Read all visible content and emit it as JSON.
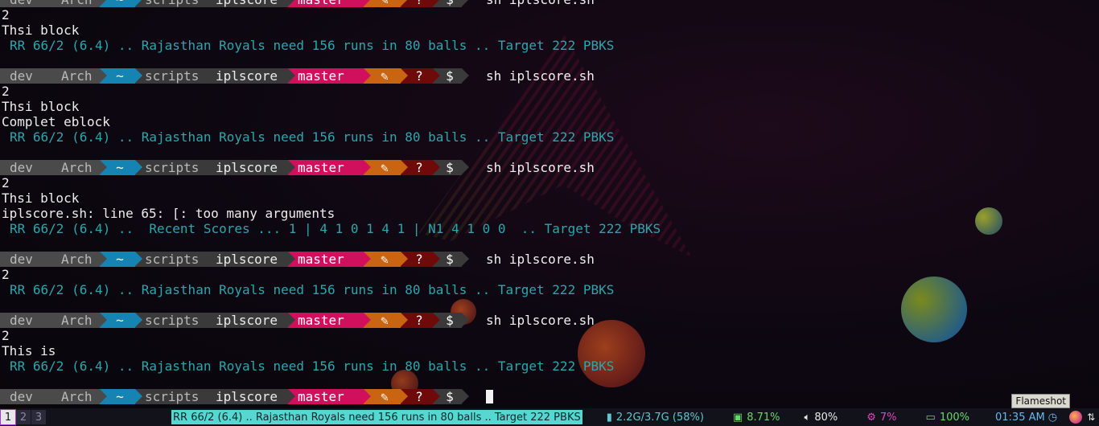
{
  "prompt": {
    "user": "dev",
    "host": "Arch",
    "home": "~",
    "dir1": "scripts",
    "dir2": "iplscore",
    "branch": "master",
    "edit": "✎",
    "status": "?",
    "symbol": "$"
  },
  "terminal_lines": [
    {
      "type": "prompt",
      "command": "sh iplscore.sh"
    },
    {
      "type": "plain",
      "text": "2"
    },
    {
      "type": "plain",
      "text": "Thsi block"
    },
    {
      "type": "score",
      "text": "RR 66/2 (6.4) .. Rajasthan Royals need 156 runs in 80 balls .. Target 222 PBKS"
    },
    {
      "type": "blank"
    },
    {
      "type": "prompt",
      "command": "sh iplscore.sh"
    },
    {
      "type": "plain",
      "text": "2"
    },
    {
      "type": "plain",
      "text": "Thsi block"
    },
    {
      "type": "plain",
      "text": "Complet eblock"
    },
    {
      "type": "score",
      "text": "RR 66/2 (6.4) .. Rajasthan Royals need 156 runs in 80 balls .. Target 222 PBKS"
    },
    {
      "type": "blank"
    },
    {
      "type": "prompt",
      "command": "sh iplscore.sh"
    },
    {
      "type": "plain",
      "text": "2"
    },
    {
      "type": "plain",
      "text": "Thsi block"
    },
    {
      "type": "plain",
      "text": "iplscore.sh: line 65: [: too many arguments"
    },
    {
      "type": "score",
      "text": "RR 66/2 (6.4) ..  Recent Scores ... 1 | 4 1 0 1 4 1 | N1 4 1 0 0  .. Target 222 PBKS"
    },
    {
      "type": "blank"
    },
    {
      "type": "prompt",
      "command": "sh iplscore.sh"
    },
    {
      "type": "plain",
      "text": "2"
    },
    {
      "type": "score",
      "text": "RR 66/2 (6.4) .. Rajasthan Royals need 156 runs in 80 balls .. Target 222 PBKS"
    },
    {
      "type": "blank"
    },
    {
      "type": "prompt",
      "command": "sh iplscore.sh"
    },
    {
      "type": "plain",
      "text": "2"
    },
    {
      "type": "plain",
      "text": "This is"
    },
    {
      "type": "score",
      "text": "RR 66/2 (6.4) .. Rajasthan Royals need 156 runs in 80 balls .. Target 222 PBKS"
    },
    {
      "type": "blank"
    },
    {
      "type": "prompt",
      "command": "",
      "cursor": true
    }
  ],
  "statusbar": {
    "workspaces": [
      "1",
      "2",
      "3"
    ],
    "active_workspace": "1",
    "window_title": "RR 66/2 (6.4) .. Rajasthan Royals need 156 runs in 80 balls .. Target 222 PBKS",
    "memory": "2.2G/3.7G (58%)",
    "cpu": "8.71%",
    "volume": "80%",
    "fan": "7%",
    "battery": "100%",
    "clock": "01:35 AM",
    "tooltip": "Flameshot"
  },
  "colors": {
    "score_text": "#2aa7ad",
    "branch_segment": "#d1105d",
    "home_segment": "#1684b3",
    "title_highlight": "#54d8d1"
  },
  "icons": {
    "memory": "memory-icon",
    "cpu": "cpu-icon",
    "volume": "volume-icon",
    "fan": "gear-icon",
    "battery": "battery-icon",
    "clock": "clock-icon",
    "tray_app": "flameshot-icon",
    "tray_net": "network-icon"
  }
}
